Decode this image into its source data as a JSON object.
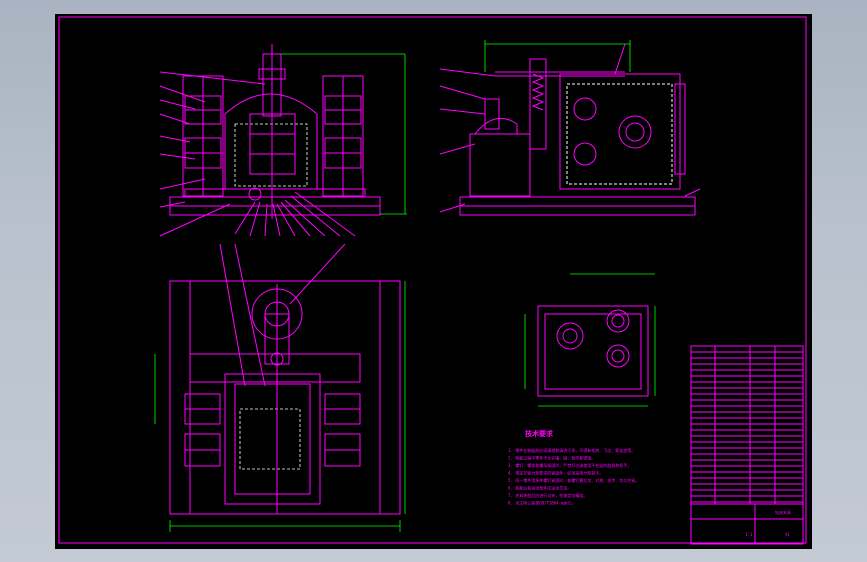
{
  "drawing": {
    "technical_requirements_title": "技术要求",
    "technical_requirements": [
      "1. 零件在装配前必须清理和清洗干净，不得有毛刺、飞边、氧化皮等。",
      "2. 装配过程中零件不允许磕、碰、划伤和锈蚀。",
      "3. 螺钉、螺栓和螺母紧固时，严禁打击或使用不合适的旋具和扳手。",
      "4. 规定拧紧力矩要求的紧固件，必须采用力矩扳手。",
      "5. 同一零件用多件螺钉紧固时，各螺钉需交叉、对称、逐步、均匀拧紧。",
      "6. 装配后各运动部件应运动灵活。",
      "7. 夹具装配后应进行试夹，检查定位精度。",
      "8. 未注明公差按GB/T1804-m执行。"
    ],
    "title_block": {
      "drawing_name": "钻床夹具",
      "scale": "1:1",
      "sheet": "A1"
    }
  },
  "colors": {
    "background": "#000000",
    "outline": "#ff00ff",
    "dimension": "#00ff00",
    "hidden": "#ffffff"
  }
}
